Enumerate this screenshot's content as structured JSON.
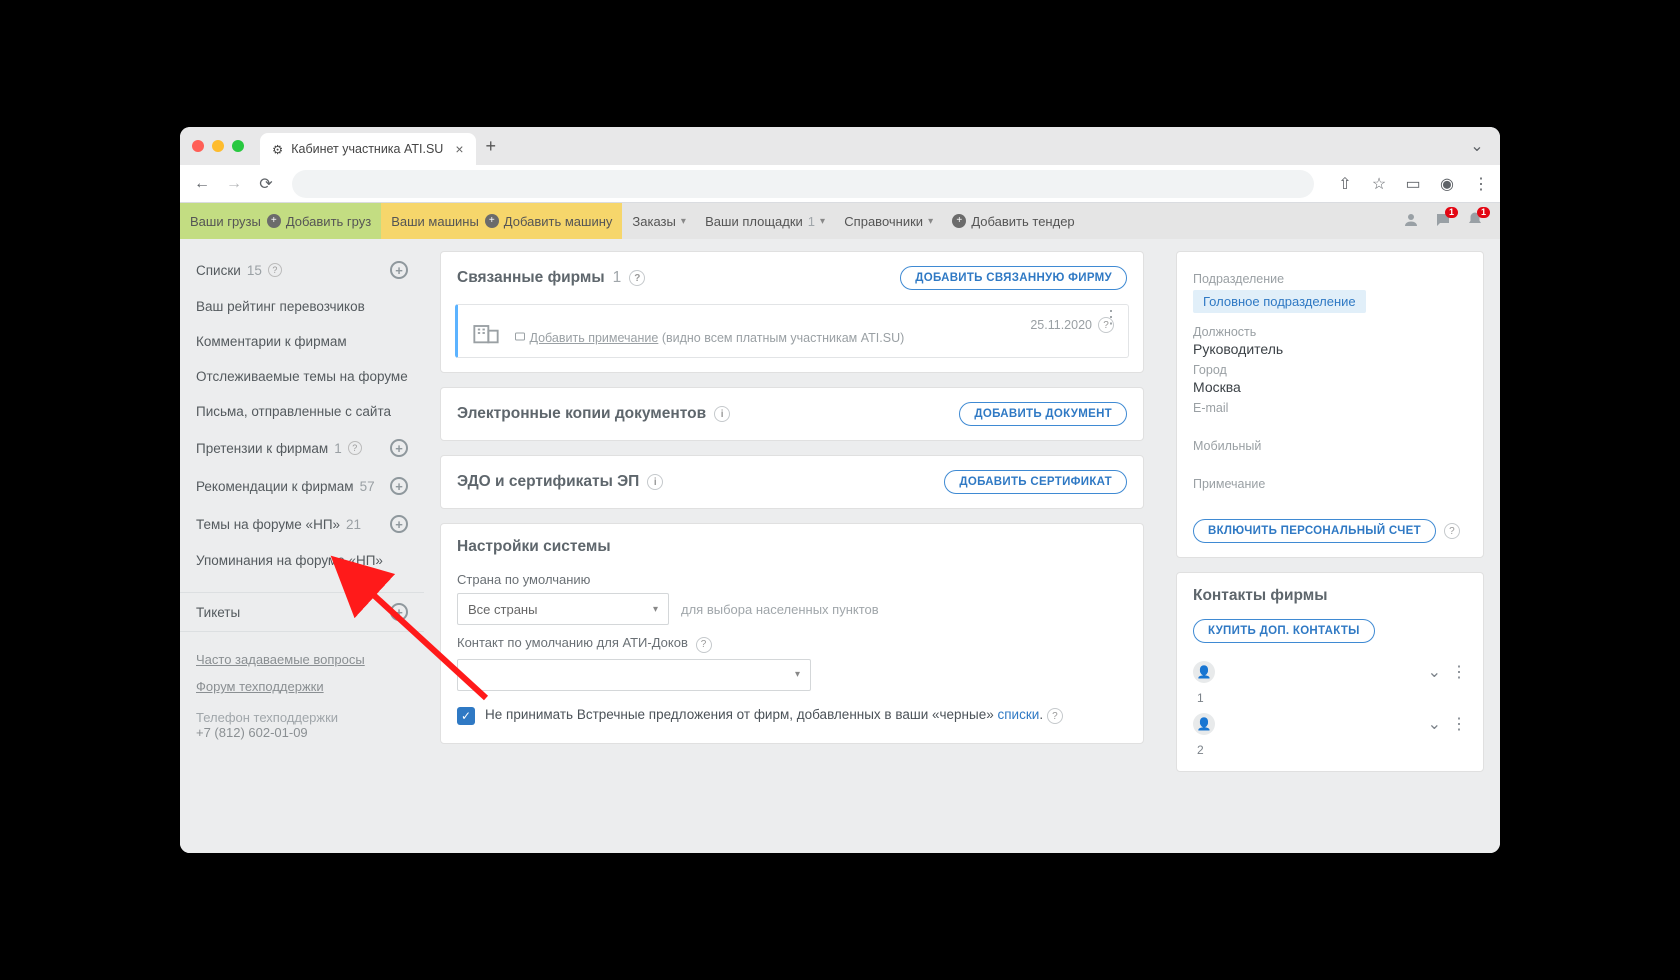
{
  "browser": {
    "tab_title": "Кабинет участника ATI.SU",
    "tab_close": "×",
    "new_tab": "+"
  },
  "topnav": {
    "your_cargo": "Ваши грузы",
    "add_cargo": "Добавить груз",
    "your_vehicles": "Ваши машины",
    "add_vehicle": "Добавить машину",
    "orders": "Заказы",
    "your_sites": "Ваши площадки",
    "your_sites_count": "1",
    "directories": "Справочники",
    "add_tender": "Добавить тендер"
  },
  "sidebar": {
    "items": [
      {
        "label": "Списки",
        "count": "15",
        "has_q": true,
        "has_plus": true
      },
      {
        "label": "Ваш рейтинг перевозчиков"
      },
      {
        "label": "Комментарии к фирмам"
      },
      {
        "label": "Отслеживаемые темы на форуме"
      },
      {
        "label": "Письма, отправленные с сайта"
      },
      {
        "label": "Претензии к фирмам",
        "count": "1",
        "has_q": true,
        "has_plus": true
      },
      {
        "label": "Рекомендации к фирмам",
        "count": "57",
        "has_plus": true
      },
      {
        "label": "Темы на форуме «НП»",
        "count": "21",
        "has_plus": true
      },
      {
        "label": "Упоминания на форуме «НП»"
      },
      {
        "label": "Тикеты",
        "has_plus": true
      }
    ],
    "faq_link": "Часто задаваемые вопросы",
    "support_link": "Форум техподдержки",
    "phone_label": "Телефон техподдержки",
    "phone": "+7 (812) 602-01-09"
  },
  "main": {
    "related_firms": {
      "title": "Связанные фирмы",
      "count": "1",
      "add_btn": "ДОБАВИТЬ СВЯЗАННУЮ ФИРМУ"
    },
    "firm_row": {
      "note_link": "Добавить примечание",
      "note_suffix": " (видно всем платным участникам ATI.SU)",
      "date": "25.11.2020"
    },
    "docs": {
      "title": "Электронные копии документов",
      "add_btn": "ДОБАВИТЬ ДОКУМЕНТ"
    },
    "edo": {
      "title": "ЭДО и сертификаты ЭП",
      "add_btn": "ДОБАВИТЬ СЕРТИФИКАТ"
    },
    "system": {
      "title": "Настройки системы",
      "country_label": "Страна по умолчанию",
      "country_value": "Все страны",
      "country_hint": "для выбора населенных пунктов",
      "contact_label": "Контакт по умолчанию для АТИ-Доков",
      "checkbox_text_pre": "Не принимать Встречные предложения от фирм, добавленных в ваши «черные» ",
      "checkbox_link": "списки",
      "checkbox_text_post": "."
    }
  },
  "right": {
    "dept_label": "Подразделение",
    "dept_chip": "Головное подразделение",
    "position_label": "Должность",
    "position_val": "Руководитель",
    "city_label": "Город",
    "city_val": "Москва",
    "email_label": "E-mail",
    "mobile_label": "Мобильный",
    "note_label": "Примечание",
    "enable_account_btn": "ВКЛЮЧИТЬ ПЕРСОНАЛЬНЫЙ СЧЕТ",
    "contacts_title": "Контакты фирмы",
    "buy_contacts_btn": "КУПИТЬ ДОП. КОНТАКТЫ",
    "contact1_num": "1",
    "contact2_num": "2"
  }
}
